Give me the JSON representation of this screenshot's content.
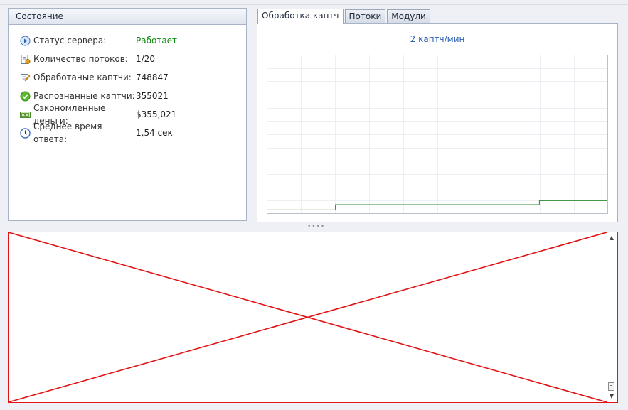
{
  "status_panel": {
    "title": "Состояние",
    "rows": [
      {
        "icon": "play-icon",
        "label": "Статус сервера:",
        "value": "Работает"
      },
      {
        "icon": "threads-icon",
        "label": "Количество потоков:",
        "value": "1/20"
      },
      {
        "icon": "edit-icon",
        "label": "Обработаные каптчи:",
        "value": "748847"
      },
      {
        "icon": "check-icon",
        "label": "Распознанные каптчи:",
        "value": "355021"
      },
      {
        "icon": "money-icon",
        "label": "Сэкономленные деньги:",
        "value": "$355,021"
      },
      {
        "icon": "clock-icon",
        "label": "Среднее время ответа:",
        "value": "1,54 сек"
      }
    ]
  },
  "tabs": [
    {
      "label": "Обработка каптч",
      "active": true
    },
    {
      "label": "Потоки",
      "active": false
    },
    {
      "label": "Модули",
      "active": false
    }
  ],
  "chart_data": {
    "type": "line",
    "title": "2 каптч/мин",
    "grid": true,
    "series_color": "#2f8a2f",
    "x": [
      0,
      10,
      20,
      30,
      40,
      50,
      60,
      70,
      80,
      90,
      100
    ],
    "values": [
      0.2,
      0.2,
      0.6,
      0.6,
      0.6,
      0.6,
      0.6,
      0.6,
      0.9,
      0.9,
      0.9
    ],
    "ylim": [
      0,
      12
    ]
  },
  "colors": {
    "accent_blue": "#2e5fb2",
    "status_ok": "#0a8a0a",
    "placeholder_red": "#e01414"
  }
}
